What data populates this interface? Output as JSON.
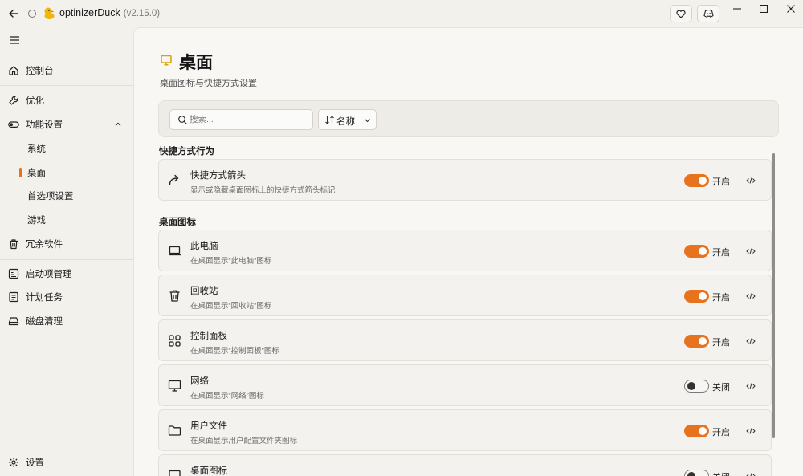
{
  "titlebar": {
    "app_name": "optinizerDuck",
    "version": "(v2.15.0)"
  },
  "sidebar": {
    "items": [
      {
        "label": "控制台",
        "icon": "home-icon"
      },
      {
        "label": "优化",
        "icon": "wrench-icon"
      },
      {
        "label": "功能设置",
        "icon": "toggle-icon"
      },
      {
        "label": "系统"
      },
      {
        "label": "桌面"
      },
      {
        "label": "首选项设置"
      },
      {
        "label": "游戏"
      },
      {
        "label": "冗余软件",
        "icon": "trash-icon"
      },
      {
        "label": "启动项管理",
        "icon": "startup-icon"
      },
      {
        "label": "计划任务",
        "icon": "task-icon"
      },
      {
        "label": "磁盘清理",
        "icon": "disk-icon"
      }
    ],
    "settings_label": "设置"
  },
  "page": {
    "title": "桌面",
    "subtitle": "桌面图标与快捷方式设置"
  },
  "toolbar": {
    "search_placeholder": "搜索...",
    "sort_label": "名称"
  },
  "sections": [
    {
      "title": "快捷方式行为",
      "items": [
        {
          "title": "快捷方式箭头",
          "description": "显示或隐藏桌面图标上的快捷方式箭头标记",
          "state": "开启",
          "on": true,
          "icon": "share-arrow-icon"
        }
      ]
    },
    {
      "title": "桌面图标",
      "items": [
        {
          "title": "此电脑",
          "description": "在桌面显示“此电脑”图标",
          "state": "开启",
          "on": true,
          "icon": "laptop-icon"
        },
        {
          "title": "回收站",
          "description": "在桌面显示“回收站”图标",
          "state": "开启",
          "on": true,
          "icon": "trash-icon"
        },
        {
          "title": "控制面板",
          "description": "在桌面显示“控制面板”图标",
          "state": "开启",
          "on": true,
          "icon": "grid-icon"
        },
        {
          "title": "网络",
          "description": "在桌面显示“网络”图标",
          "state": "关闭",
          "on": false,
          "icon": "monitor-icon"
        },
        {
          "title": "用户文件",
          "description": "在桌面显示用户配置文件夹图标",
          "state": "开启",
          "on": true,
          "icon": "folder-icon"
        },
        {
          "title": "桌面图标",
          "description": "",
          "state": "关闭",
          "on": false,
          "icon": "window-icon"
        }
      ]
    }
  ],
  "colors": {
    "accent": "#e8731f",
    "background": "#f3f1ec",
    "panel": "#f8f7f4"
  }
}
